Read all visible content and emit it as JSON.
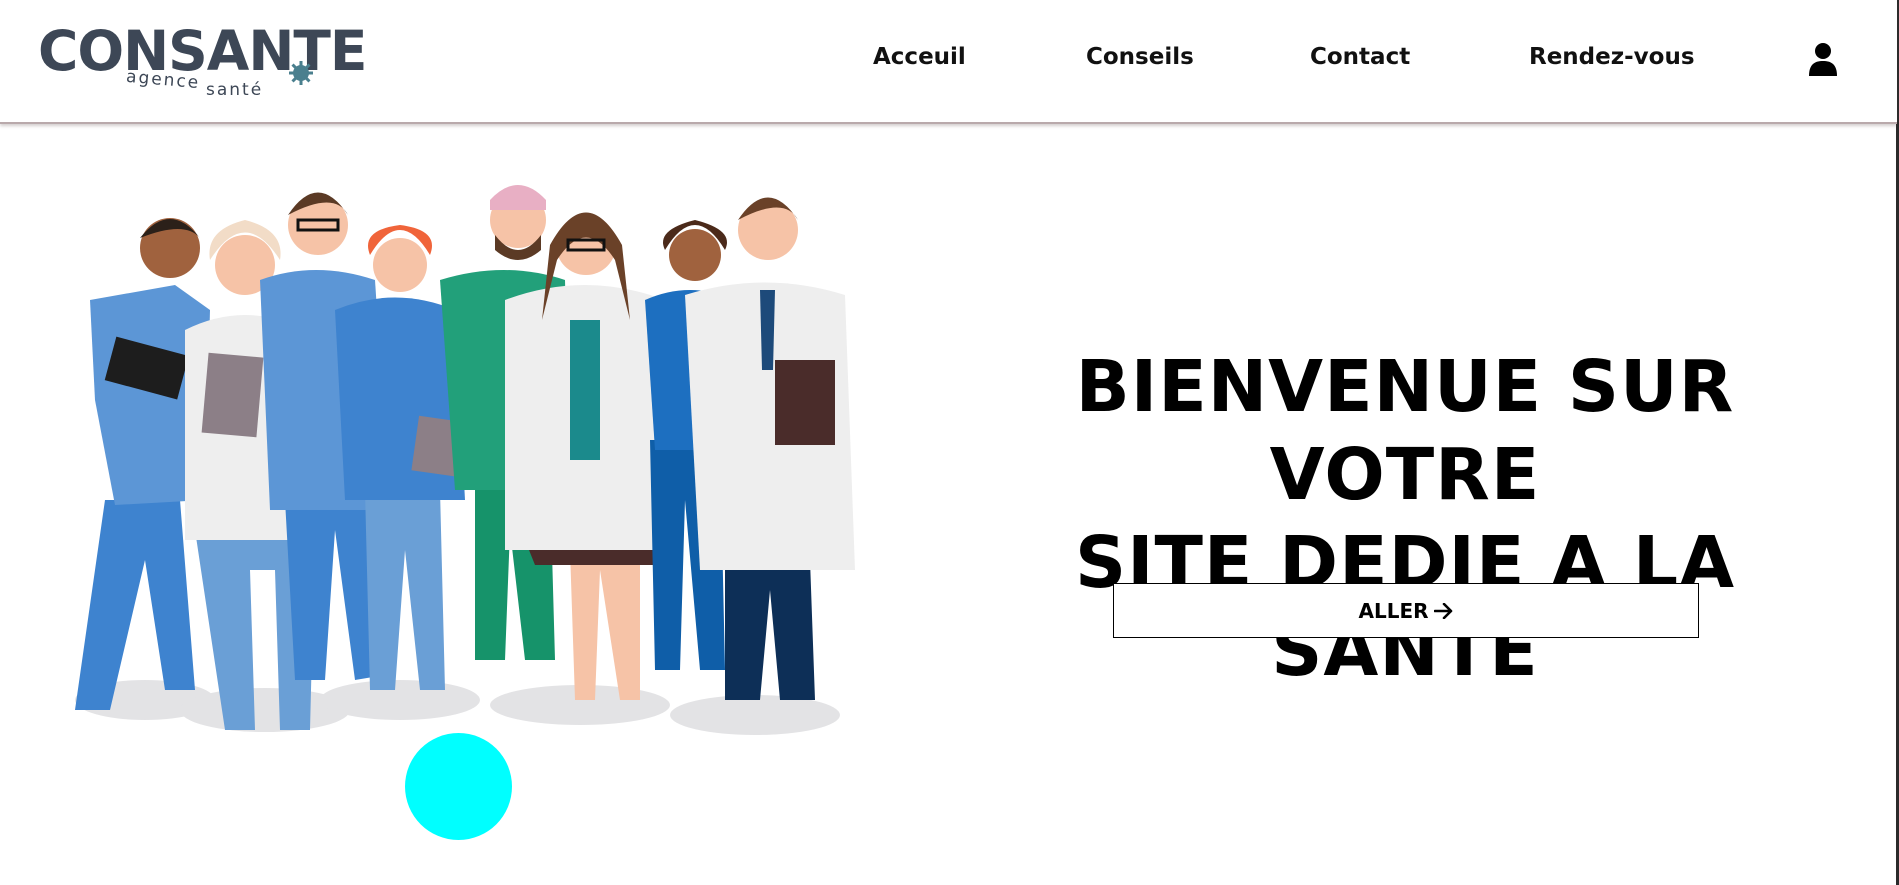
{
  "header": {
    "logo": {
      "wordmark": "CONSANTE",
      "tagline_part1": "agence",
      "tagline_part2": "santé"
    },
    "nav": [
      {
        "label": "Acceuil"
      },
      {
        "label": "Conseils"
      },
      {
        "label": "Contact"
      },
      {
        "label": "Rendez-vous"
      }
    ],
    "user_icon": "user-icon"
  },
  "hero": {
    "title_lines": [
      "BIENVENUE SUR VOTRE",
      "SITE DEDIE A LA",
      "SANTE"
    ],
    "button_label": "ALLER",
    "button_icon": "arrow-right-icon",
    "illustration": "medical-team-illustration",
    "dot_color": "#00ffff"
  },
  "colors": {
    "logo": "#3d4756",
    "accent_dot": "#00ffff",
    "header_border": "#b9a9ab"
  }
}
